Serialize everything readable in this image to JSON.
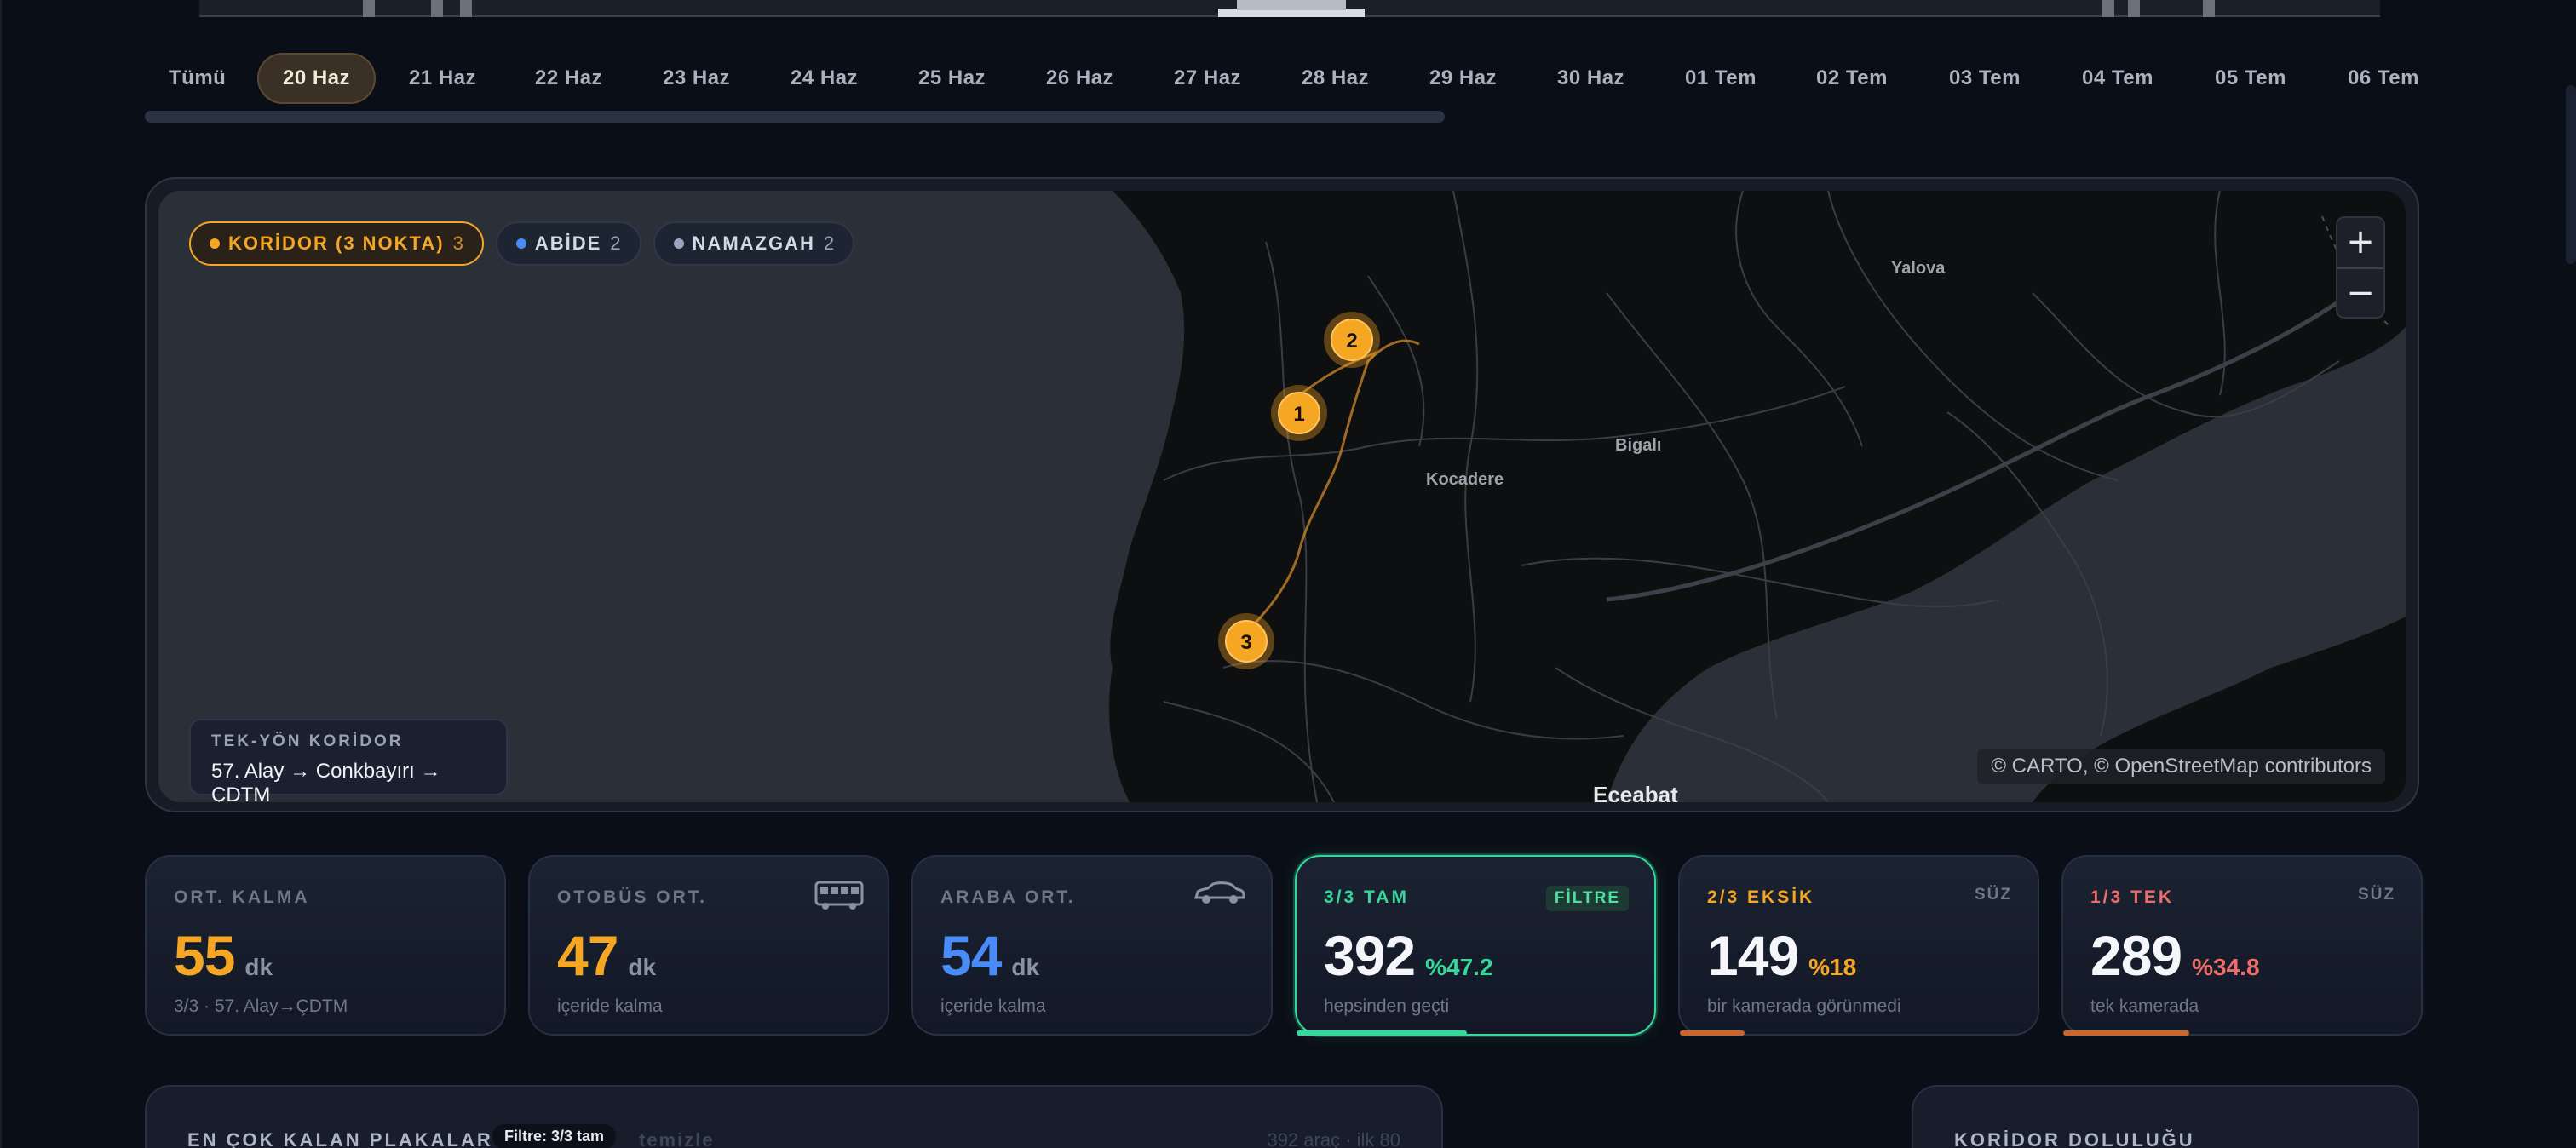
{
  "date_tabs": {
    "items": [
      {
        "label": "Tümü",
        "active": false
      },
      {
        "label": "20 Haz",
        "active": true
      },
      {
        "label": "21 Haz",
        "active": false
      },
      {
        "label": "22 Haz",
        "active": false
      },
      {
        "label": "23 Haz",
        "active": false
      },
      {
        "label": "24 Haz",
        "active": false
      },
      {
        "label": "25 Haz",
        "active": false
      },
      {
        "label": "26 Haz",
        "active": false
      },
      {
        "label": "27 Haz",
        "active": false
      },
      {
        "label": "28 Haz",
        "active": false
      },
      {
        "label": "29 Haz",
        "active": false
      },
      {
        "label": "30 Haz",
        "active": false
      },
      {
        "label": "01 Tem",
        "active": false
      },
      {
        "label": "02 Tem",
        "active": false
      },
      {
        "label": "03 Tem",
        "active": false
      },
      {
        "label": "04 Tem",
        "active": false
      },
      {
        "label": "05 Tem",
        "active": false
      },
      {
        "label": "06 Tem",
        "active": false
      }
    ]
  },
  "map": {
    "filters": [
      {
        "label": "KORİDOR (3 NOKTA)",
        "count": "3",
        "color": "#f5a623",
        "active": true
      },
      {
        "label": "ABİDE",
        "count": "2",
        "color": "#4a8cf7",
        "active": false
      },
      {
        "label": "NAMAZGAH",
        "count": "2",
        "color": "#9aa6bf",
        "active": false
      }
    ],
    "zoom_in": "+",
    "zoom_out": "−",
    "markers": [
      "1",
      "2",
      "3"
    ],
    "place_labels": {
      "yalova": "Yalova",
      "bigali": "Bigalı",
      "kocadere": "Kocadere",
      "eceabat": "Eceabat"
    },
    "route_box": {
      "kicker": "TEK-YÖN KORİDOR",
      "route": "57. Alay → Conkbayırı → ÇDTM"
    },
    "attribution": "© CARTO, © OpenStreetMap contributors"
  },
  "stats": {
    "ort_kalma": {
      "label": "ORT. KALMA",
      "value": "55",
      "unit": "dk",
      "sub": "3/3 · 57. Alay→ÇDTM",
      "color": "#f5a623"
    },
    "otobus": {
      "label": "OTOBÜS ORT.",
      "value": "47",
      "unit": "dk",
      "sub": "içeride kalma",
      "color": "#f5a623",
      "icon": "bus-icon"
    },
    "araba": {
      "label": "ARABA ORT.",
      "value": "54",
      "unit": "dk",
      "sub": "içeride kalma",
      "color": "#4a8cf7",
      "icon": "car-icon"
    },
    "tam": {
      "label": "3/3 TAM",
      "tag": "FİLTRE",
      "value": "392",
      "pct": "%47.2",
      "sub": "hepsinden geçti",
      "color": "#35d89a",
      "fill": 0.472
    },
    "eksik": {
      "label": "2/3 EKSİK",
      "tag": "SÜZ",
      "value": "149",
      "pct": "%18",
      "sub": "bir kamerada görünmedi",
      "color": "#f5a623",
      "fill": 0.18
    },
    "tek": {
      "label": "1/3 TEK",
      "tag": "SÜZ",
      "value": "289",
      "pct": "%34.8",
      "sub": "tek kamerada",
      "color": "#f06c6c",
      "fill": 0.348
    }
  },
  "bottom": {
    "plates_title": "EN ÇOK KALAN PLAKALAR",
    "plates_filter": "Filtre: 3/3 tam",
    "plates_clear": "temizle",
    "plates_meta": "392 araç · ilk 80",
    "occupancy_title": "KORİDOR DOLULUĞU"
  }
}
